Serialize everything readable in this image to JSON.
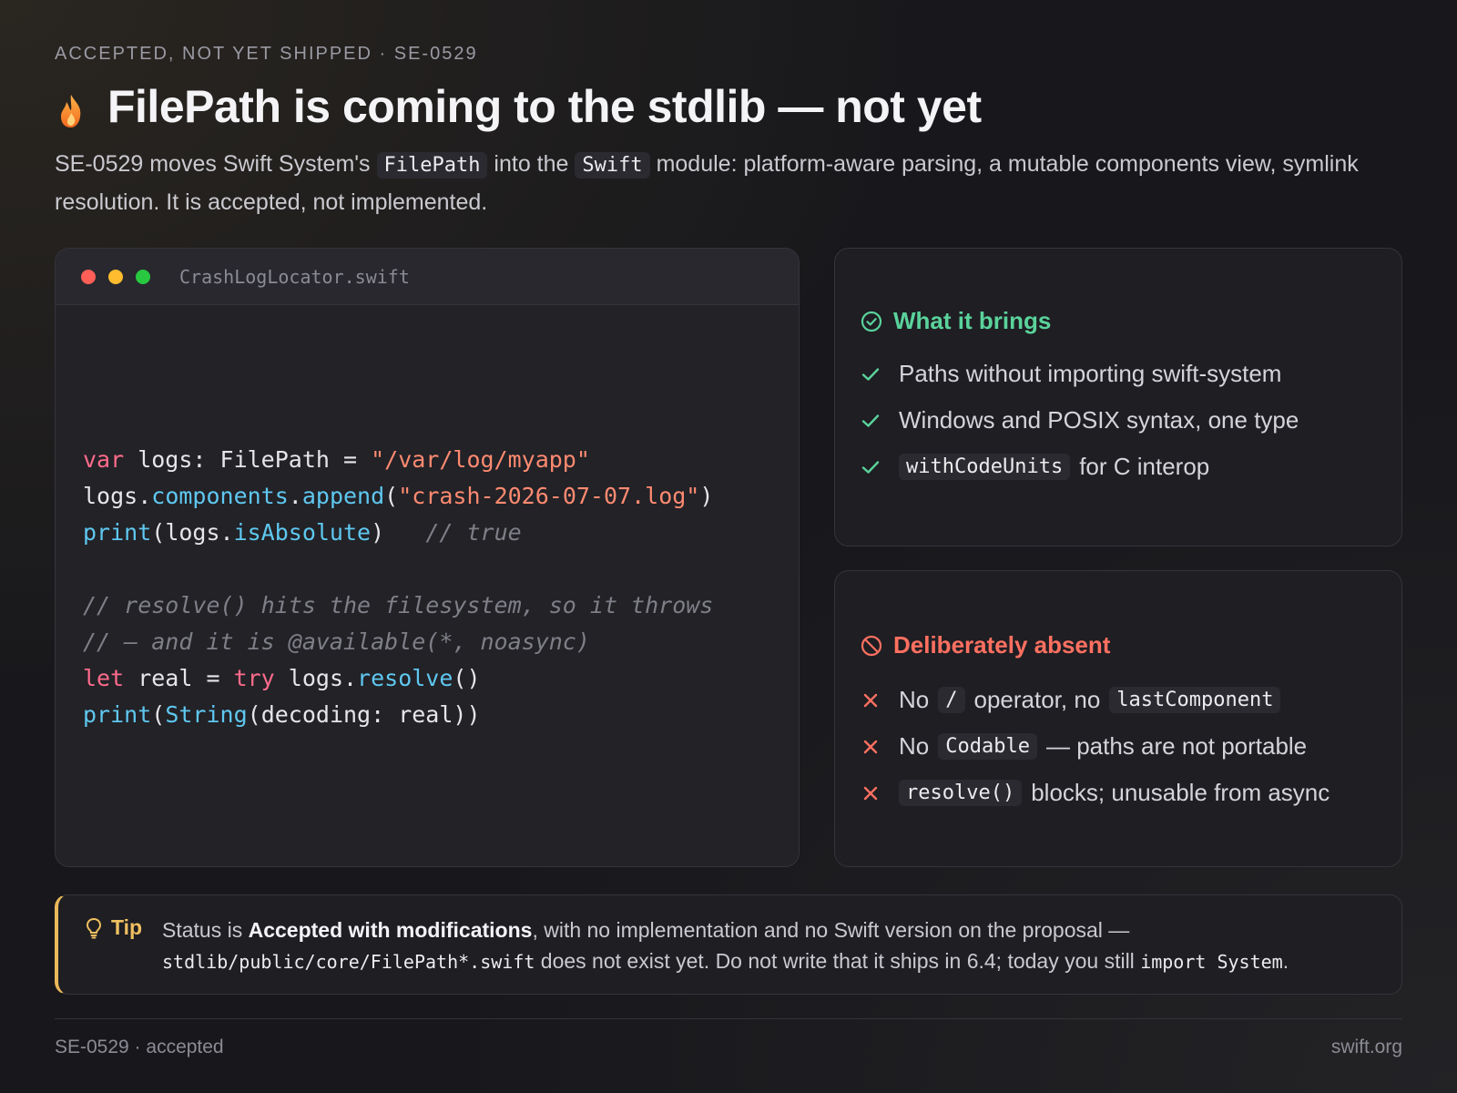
{
  "header": {
    "eyebrow": "ACCEPTED, NOT YET SHIPPED · SE-0529",
    "title": "FilePath is coming to the stdlib — not yet",
    "title_icon": "flame-icon",
    "lede": {
      "part1": "SE-0529 moves Swift System's ",
      "chip1": "FilePath",
      "part2": " into the ",
      "chip2": "Swift",
      "part3": " module: platform-aware parsing, a mutable components view, symlink resolution. It is accepted, not implemented."
    }
  },
  "code_window": {
    "filename": "CrashLogLocator.swift",
    "dot_colors": [
      "#ff5f57",
      "#febc2e",
      "#28c840"
    ],
    "lines": [
      [
        {
          "t": "var",
          "c": "kw"
        },
        {
          "t": " logs: FilePath = "
        },
        {
          "t": "\"/var/log/myapp\"",
          "c": "str"
        }
      ],
      [
        {
          "t": "logs."
        },
        {
          "t": "components",
          "c": "fn"
        },
        {
          "t": "."
        },
        {
          "t": "append",
          "c": "fn"
        },
        {
          "t": "("
        },
        {
          "t": "\"crash-2026-07-07.log\"",
          "c": "str"
        },
        {
          "t": ")"
        }
      ],
      [
        {
          "t": "print",
          "c": "fn"
        },
        {
          "t": "(logs."
        },
        {
          "t": "isAbsolute",
          "c": "fn"
        },
        {
          "t": ")   "
        },
        {
          "t": "// true",
          "c": "cm"
        }
      ],
      [],
      [
        {
          "t": "// resolve() hits the filesystem, so it throws",
          "c": "cm"
        }
      ],
      [
        {
          "t": "// — and it is @available(*, noasync)",
          "c": "cm"
        }
      ],
      [
        {
          "t": "let",
          "c": "kw"
        },
        {
          "t": " real = "
        },
        {
          "t": "try",
          "c": "kw"
        },
        {
          "t": " logs."
        },
        {
          "t": "resolve",
          "c": "fn"
        },
        {
          "t": "()"
        }
      ],
      [
        {
          "t": "print",
          "c": "fn"
        },
        {
          "t": "("
        },
        {
          "t": "String",
          "c": "fn"
        },
        {
          "t": "(decoding: real))"
        }
      ]
    ]
  },
  "brings": {
    "heading": "What it brings",
    "icon": "check-circle-icon",
    "color": "#5ad39b",
    "items": [
      {
        "text": "Paths without importing swift-system"
      },
      {
        "text": "Windows and POSIX syntax, one type"
      },
      {
        "code": "withCodeUnits",
        "text": "for C interop"
      }
    ]
  },
  "absent": {
    "heading": "Deliberately absent",
    "icon": "prohibited-icon",
    "color": "#ff7060",
    "items": [
      {
        "pre": "No",
        "code": "/",
        "text": "operator, no",
        "code2": "lastComponent"
      },
      {
        "pre": "No",
        "code": "Codable",
        "text": "— paths are not portable"
      },
      {
        "code": "resolve()",
        "text": "blocks; unusable from async"
      }
    ]
  },
  "tip": {
    "label": "Tip",
    "icon": "lightbulb-icon",
    "accent": "#e8b85a",
    "t1": "Status is ",
    "bold": "Accepted with modifications",
    "t2": ", with no implementation and no Swift version on the proposal —",
    "code1": "stdlib/public/core/FilePath*.swift",
    "t3": " does not exist yet. Do not write that it ships in 6.4; today you still ",
    "code2": "import System",
    "t4": "."
  },
  "footer": {
    "left": "SE-0529 · accepted",
    "right": "swift.org"
  }
}
